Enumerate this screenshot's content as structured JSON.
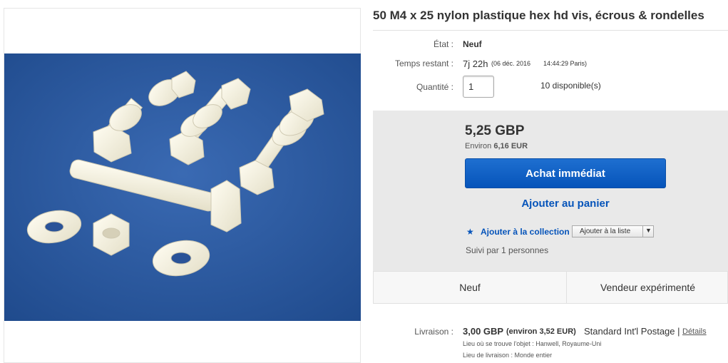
{
  "listing": {
    "title": "50 M4 x 25 nylon plastique hex hd vis, écrous & rondelles"
  },
  "details": {
    "condition_label": "État :",
    "condition_value": "Neuf",
    "time_label": "Temps restant :",
    "time_value": "7j 22h",
    "time_date": "(06 déc. 2016",
    "time_clock": "14:44:29 Paris)",
    "qty_label": "Quantité :",
    "qty_value": "1",
    "available": "10 disponible(s)"
  },
  "purchase": {
    "price": "5,25 GBP",
    "approx_prefix": "Environ",
    "approx_value": "6,16 EUR",
    "buy_now_label": "Achat immédiat",
    "add_to_cart_label": "Ajouter au panier",
    "add_collection_label": "Ajouter à la collection",
    "add_list_label": "Ajouter à la liste",
    "followers": "Suivi par 1 personnes"
  },
  "badges": {
    "condition": "Neuf",
    "seller": "Vendeur expérimenté"
  },
  "shipping": {
    "label": "Livraison :",
    "price": "3,00 GBP",
    "approx_prefix": "(environ",
    "approx_value": "3,52 EUR)",
    "method": "Standard Int'l Postage |",
    "details_link": "Détails",
    "location": "Lieu où se trouve l'objet : Hanwell, Royaume-Uni",
    "destination": "Lieu de livraison : Monde entier"
  },
  "colors": {
    "accent_blue": "#0654ba",
    "buy_box_bg": "#e9e9e9",
    "photo_bg": "#2c5aa0"
  },
  "icons": {
    "collection": "star-icon",
    "dropdown": "chevron-down-icon"
  }
}
